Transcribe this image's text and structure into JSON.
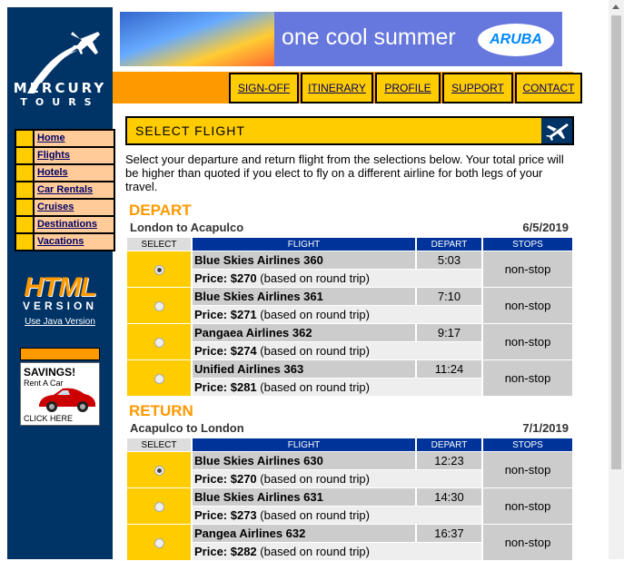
{
  "sidebar": {
    "brand": "MERCURY",
    "brand_sub": "TOURS",
    "nav": [
      {
        "label": "Home"
      },
      {
        "label": "Flights"
      },
      {
        "label": "Hotels"
      },
      {
        "label": "Car Rentals"
      },
      {
        "label": "Cruises"
      },
      {
        "label": "Destinations"
      },
      {
        "label": "Vacations"
      }
    ],
    "html_version": "HTML",
    "html_version_sub": "VERSION",
    "java_link": "Use Java Version",
    "ad": {
      "line1": "SAVINGS!",
      "line2": "Rent A Car",
      "line3": "CLICK HERE"
    }
  },
  "banner": {
    "tagline": "one cool summer",
    "logo": "ARUBA"
  },
  "menu": [
    "SIGN-OFF",
    "ITINERARY",
    "PROFILE",
    "SUPPORT",
    "CONTACT"
  ],
  "select_flight": {
    "title": "SELECT FLIGHT"
  },
  "intro": "Select your departure and return flight from the selections below. Your total price will be higher than quoted if you elect to fly on a different airline for both legs of your travel.",
  "headers": {
    "select": "SELECT",
    "flight": "FLIGHT",
    "depart": "DEPART",
    "stops": "STOPS"
  },
  "depart": {
    "heading": "DEPART",
    "route": "London to Acapulco",
    "date": "6/5/2019",
    "flights": [
      {
        "name": "Blue Skies Airlines 360",
        "time": "5:03",
        "stops": "non-stop",
        "price": "Price: $270",
        "note": "(based on round trip)",
        "selected": true
      },
      {
        "name": "Blue Skies Airlines 361",
        "time": "7:10",
        "stops": "non-stop",
        "price": "Price: $271",
        "note": "(based on round trip)",
        "selected": false
      },
      {
        "name": "Pangaea Airlines 362",
        "time": "9:17",
        "stops": "non-stop",
        "price": "Price: $274",
        "note": "(based on round trip)",
        "selected": false
      },
      {
        "name": "Unified Airlines 363",
        "time": "11:24",
        "stops": "non-stop",
        "price": "Price: $281",
        "note": "(based on round trip)",
        "selected": false
      }
    ]
  },
  "return": {
    "heading": "RETURN",
    "route": "Acapulco to London",
    "date": "7/1/2019",
    "flights": [
      {
        "name": "Blue Skies Airlines 630",
        "time": "12:23",
        "stops": "non-stop",
        "price": "Price: $270",
        "note": "(based on round trip)",
        "selected": true
      },
      {
        "name": "Blue Skies Airlines 631",
        "time": "14:30",
        "stops": "non-stop",
        "price": "Price: $273",
        "note": "(based on round trip)",
        "selected": false
      },
      {
        "name": "Pangea Airlines 632",
        "time": "16:37",
        "stops": "non-stop",
        "price": "Price: $282",
        "note": "(based on round trip)",
        "selected": false
      }
    ]
  },
  "colors": {
    "navy": "#003366",
    "orange": "#ff9900",
    "yellow": "#ffcc00",
    "blue": "#003399"
  }
}
